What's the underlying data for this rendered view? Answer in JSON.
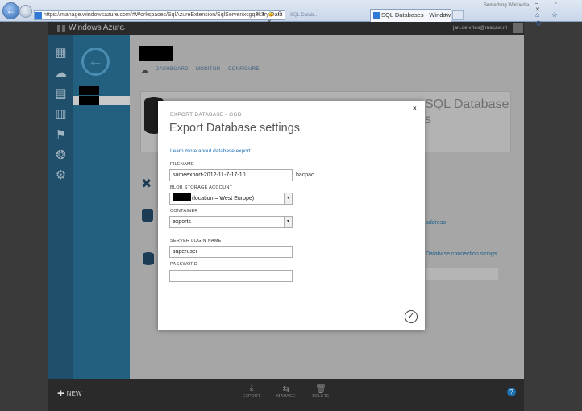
{
  "browser": {
    "address": "https://manage.windowsazure.com/#Workspaces/SqlAzureExtension/SqlServer/xcgq2k3ry/Data",
    "address_tools": "⌕ ▾ 🔒 ⟳ ✕",
    "background_tab": "SQL Datab…",
    "tab_title": "SQL Databases - Windows ...",
    "tab_close": "×",
    "bookmark": "Something Wikipedia",
    "back_glyph": "←",
    "forward_glyph": "→",
    "window_buttons": "‒ ▫ ✕",
    "tray_icons": "⌂ ☆ ⚙"
  },
  "header": {
    "product": "Windows Azure",
    "caret": "⌄",
    "user_email": "jan.de.vries@macaw.nl"
  },
  "page": {
    "tabs": [
      "DASHBOARD",
      "MONITOR",
      "CONFIGURE"
    ],
    "hero_lines": [
      "SQL Database",
      "s"
    ],
    "links": [
      "address",
      "Database connection strings"
    ]
  },
  "commands": {
    "new_label": "NEW",
    "items": [
      {
        "label": "EXPORT",
        "icon": "export-icon",
        "glyph": "⤓"
      },
      {
        "label": "MANAGE",
        "icon": "manage-icon",
        "glyph": "⇆"
      },
      {
        "label": "DELETE",
        "icon": "delete-icon",
        "glyph": "🗑"
      }
    ],
    "help": "?"
  },
  "modal": {
    "eyebrow": "EXPORT DATABASE - GGD",
    "title": "Export Database settings",
    "close": "×",
    "learn_link": "Learn more about database export",
    "fields": {
      "filename_label": "FILENAME",
      "filename_value": "someexport-2012-11-7-17-10",
      "filename_suffix": ".bacpac",
      "storage_label": "BLOB STORAGE ACCOUNT",
      "storage_value": "(location = West Europe)",
      "container_label": "CONTAINER",
      "container_value": "exports",
      "login_label": "SERVER LOGIN NAME",
      "login_value": "superuser",
      "password_label": "PASSWORD",
      "password_value": ""
    },
    "dropdown_glyph": "▾",
    "ok_glyph": "✓"
  },
  "colors": {
    "icon_rail": "#1f4f6a",
    "nav_rail": "#23607f",
    "link": "#1a6eb5",
    "command_bar": "#2a2a2a"
  }
}
